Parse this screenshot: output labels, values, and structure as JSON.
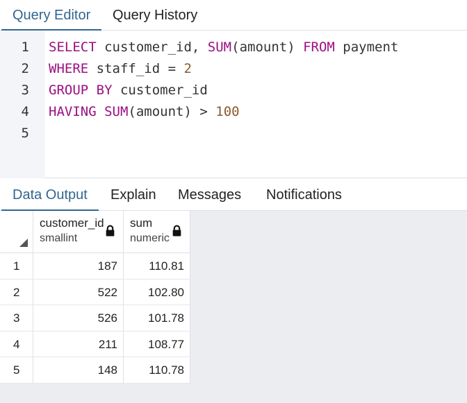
{
  "editor_tabs": [
    {
      "label": "Query Editor",
      "active": true
    },
    {
      "label": "Query History",
      "active": false
    }
  ],
  "code": {
    "line_numbers": [
      "1",
      "2",
      "3",
      "4",
      "5"
    ],
    "lines": [
      [
        {
          "t": "SELECT",
          "c": "kw"
        },
        {
          "t": " customer_id, ",
          "c": "plain"
        },
        {
          "t": "SUM",
          "c": "fn"
        },
        {
          "t": "(amount) ",
          "c": "plain"
        },
        {
          "t": "FROM",
          "c": "kw"
        },
        {
          "t": " payment",
          "c": "plain"
        }
      ],
      [
        {
          "t": "WHERE",
          "c": "kw"
        },
        {
          "t": " staff_id = ",
          "c": "plain"
        },
        {
          "t": "2",
          "c": "num"
        }
      ],
      [
        {
          "t": "GROUP BY",
          "c": "kw"
        },
        {
          "t": " customer_id",
          "c": "plain"
        }
      ],
      [
        {
          "t": "HAVING",
          "c": "kw"
        },
        {
          "t": " ",
          "c": "plain"
        },
        {
          "t": "SUM",
          "c": "fn"
        },
        {
          "t": "(amount) > ",
          "c": "plain"
        },
        {
          "t": "100",
          "c": "num"
        }
      ],
      []
    ]
  },
  "output_tabs": [
    {
      "label": "Data Output",
      "active": true
    },
    {
      "label": "Explain",
      "active": false
    },
    {
      "label": "Messages",
      "active": false
    },
    {
      "label": "Notifications",
      "active": false
    }
  ],
  "grid": {
    "columns": [
      {
        "name": "customer_id",
        "type": "smallint",
        "locked": true
      },
      {
        "name": "sum",
        "type": "numeric",
        "locked": true
      }
    ],
    "rows": [
      {
        "num": "1",
        "customer_id": "187",
        "sum": "110.81"
      },
      {
        "num": "2",
        "customer_id": "522",
        "sum": "102.80"
      },
      {
        "num": "3",
        "customer_id": "526",
        "sum": "101.78"
      },
      {
        "num": "4",
        "customer_id": "211",
        "sum": "108.77"
      },
      {
        "num": "5",
        "customer_id": "148",
        "sum": "110.78"
      }
    ]
  },
  "icons": {
    "lock": "lock-icon",
    "corner": "select-all-triangle-icon"
  },
  "colors": {
    "accent": "#326690",
    "keyword": "#9b0f82",
    "number": "#8a5a2e",
    "gutter": "#f3f5f8",
    "grid_bg": "#ebedf1"
  }
}
